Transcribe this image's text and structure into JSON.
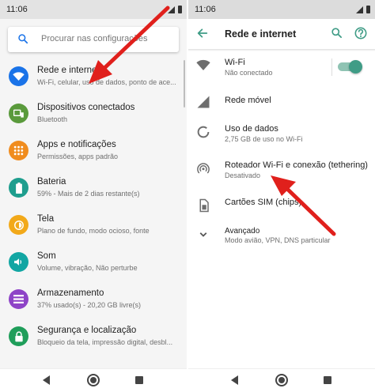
{
  "left_screen": {
    "status_time": "11:06",
    "search_placeholder": "Procurar nas configurações",
    "items": [
      {
        "title": "Rede e internet",
        "subtitle": "Wi-Fi, celular, uso de dados, ponto de ace...",
        "icon": "wifi-icon",
        "color": "#1a73e8"
      },
      {
        "title": "Dispositivos conectados",
        "subtitle": "Bluetooth",
        "icon": "devices-icon",
        "color": "#5a9a3c"
      },
      {
        "title": "Apps e notificações",
        "subtitle": "Permissões, apps padrão",
        "icon": "apps-icon",
        "color": "#f08c1e"
      },
      {
        "title": "Bateria",
        "subtitle": "59% - Mais de 2 dias restante(s)",
        "icon": "battery-icon",
        "color": "#1e9e8e"
      },
      {
        "title": "Tela",
        "subtitle": "Plano de fundo, modo ocioso, fonte",
        "icon": "display-icon",
        "color": "#f2a91a"
      },
      {
        "title": "Som",
        "subtitle": "Volume, vibração, Não perturbe",
        "icon": "sound-icon",
        "color": "#12a6a3"
      },
      {
        "title": "Armazenamento",
        "subtitle": "37% usado(s) - 20,20 GB livre(s)",
        "icon": "storage-icon",
        "color": "#8e44c7"
      },
      {
        "title": "Segurança e localização",
        "subtitle": "Bloqueio da tela, impressão digital, desbl...",
        "icon": "lock-icon",
        "color": "#1f9e5a"
      }
    ]
  },
  "right_screen": {
    "status_time": "11:06",
    "title": "Rede e internet",
    "items": [
      {
        "title": "Wi-Fi",
        "subtitle": "Não conectado",
        "icon": "wifi-icon"
      },
      {
        "title": "Rede móvel",
        "subtitle": "",
        "icon": "signal-icon"
      },
      {
        "title": "Uso de dados",
        "subtitle": "2,75 GB de uso no Wi-Fi",
        "icon": "data-usage-icon"
      },
      {
        "title": "Roteador Wi-Fi e conexão (tethering)",
        "subtitle": "Desativado",
        "icon": "hotspot-icon"
      },
      {
        "title": "Cartões SIM (chips)",
        "subtitle": "",
        "icon": "sim-card-icon"
      },
      {
        "title": "Avançado",
        "subtitle": "Modo avião, VPN, DNS particular",
        "icon": "chevron-down-icon"
      }
    ],
    "wifi_toggle_on": true
  },
  "colors": {
    "accent": "#3f9c86",
    "arrow": "#e0201c"
  }
}
